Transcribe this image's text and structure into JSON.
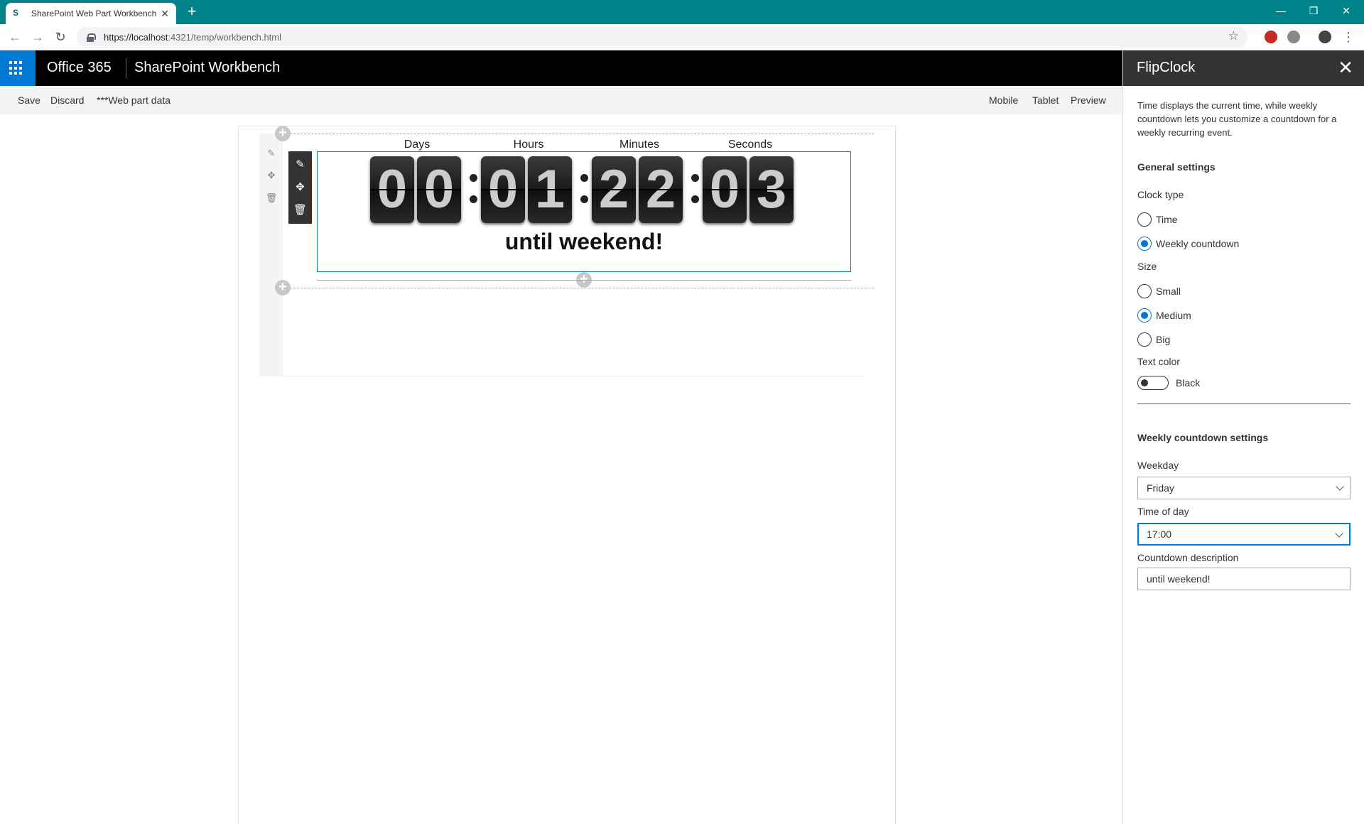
{
  "browser": {
    "tab_title": "SharePoint Web Part Workbench",
    "tab_close": "✕",
    "new_tab": "+",
    "url_host": "https://localhost",
    "url_rest": ":4321/temp/workbench.html",
    "window_minimize": "—",
    "window_restore": "❐",
    "window_close": "✕"
  },
  "suite": {
    "brand": "Office 365",
    "title": "SharePoint Workbench"
  },
  "command_bar": {
    "left": [
      "Save",
      "Discard",
      "***Web part data"
    ],
    "right": [
      "Mobile",
      "Tablet",
      "Preview"
    ]
  },
  "clock": {
    "labels": [
      "Days",
      "Hours",
      "Minutes",
      "Seconds"
    ],
    "digits": [
      "0",
      "0",
      "0",
      "1",
      "2",
      "2",
      "0",
      "3"
    ],
    "description": "until weekend!"
  },
  "pane": {
    "title": "FlipClock",
    "close": "✕",
    "description": "Time displays the current time, while weekly countdown lets you customize a countdown for a weekly recurring event.",
    "general_title": "General settings",
    "clock_type_label": "Clock type",
    "clock_type_options": [
      "Time",
      "Weekly countdown"
    ],
    "clock_type_selected": "Weekly countdown",
    "size_label": "Size",
    "size_options": [
      "Small",
      "Medium",
      "Big"
    ],
    "size_selected": "Medium",
    "text_color_label": "Text color",
    "text_color_value": "Black",
    "weekly_title": "Weekly countdown settings",
    "weekday_label": "Weekday",
    "weekday_value": "Friday",
    "time_label": "Time of day",
    "time_value": "17:00",
    "countdown_desc_label": "Countdown description",
    "countdown_desc_value": "until weekend!"
  },
  "colors": {
    "browser_frame": "#00838a",
    "suite_bar": "#000000",
    "waffle": "#0078d4",
    "accent": "#0078d4",
    "pane_header": "#333333"
  }
}
